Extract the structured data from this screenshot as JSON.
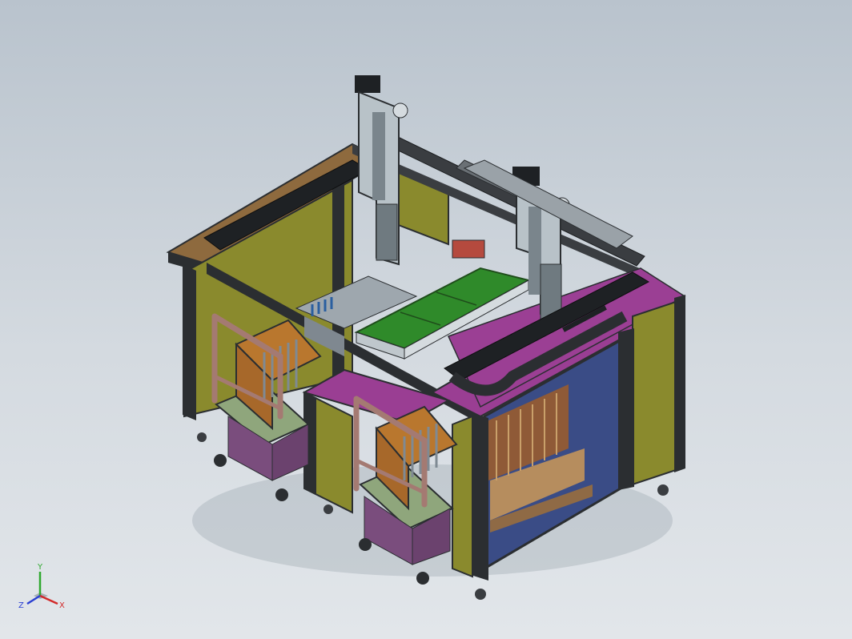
{
  "viewport": {
    "triad": {
      "x_label": "X",
      "y_label": "Y",
      "z_label": "Z",
      "x_color": "#d22a2a",
      "y_color": "#2fa82f",
      "z_color": "#2a3fd2"
    }
  },
  "colors": {
    "frame_dark": "#2b2e31",
    "panel_olive": "#8c8a2a",
    "panel_magenta": "#9a3e93",
    "panel_brown": "#9a6b3d",
    "pcb_green": "#2f8a2a",
    "cart_base": "#7a4d7d",
    "cart_top": "#8fa67c",
    "handle_pipe": "#a47a72",
    "crate_orange": "#b9772e",
    "glass_blue": "#3a4c86"
  }
}
